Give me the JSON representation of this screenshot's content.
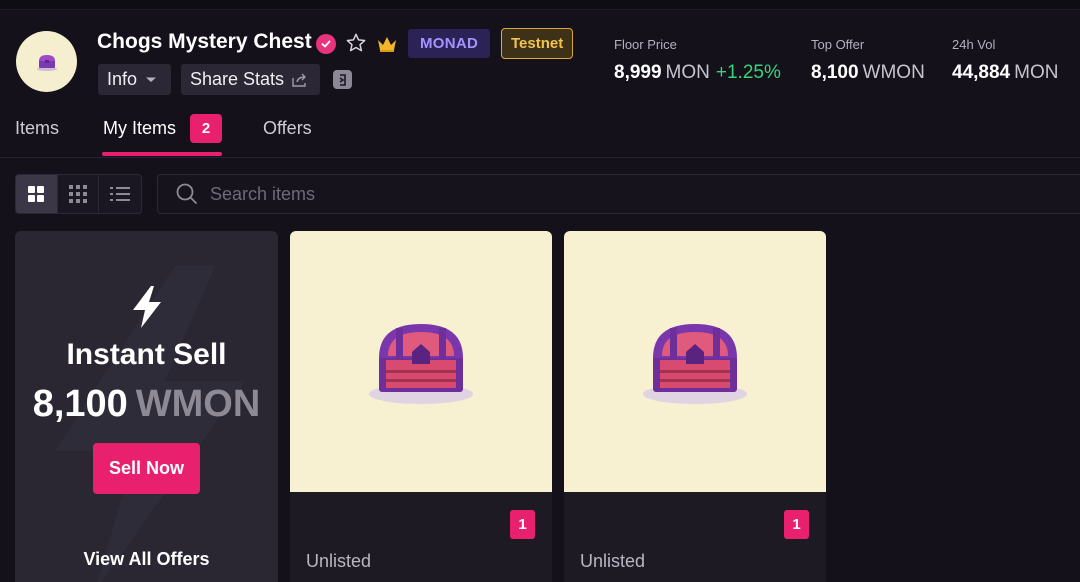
{
  "collection": {
    "name": "Chogs Mystery Chest",
    "network_tag": "MONAD",
    "env_tag": "Testnet",
    "info_label": "Info",
    "share_label": "Share Stats"
  },
  "stats": {
    "floor": {
      "label": "Floor Price",
      "value": "8,999",
      "unit": "MON",
      "change": "+1.25%"
    },
    "top_offer": {
      "label": "Top Offer",
      "value": "8,100",
      "unit": "WMON"
    },
    "volume": {
      "label": "24h Vol",
      "value": "44,884",
      "unit": "MON"
    }
  },
  "tabs": {
    "items": "Items",
    "my_items": "My Items",
    "my_items_count": "2",
    "offers": "Offers"
  },
  "search": {
    "placeholder": "Search items"
  },
  "instant_sell": {
    "title": "Instant Sell",
    "amount": "8,100",
    "unit": "WMON",
    "button": "Sell Now",
    "view_all": "View All Offers"
  },
  "items": [
    {
      "quantity": "1",
      "status": "Unlisted"
    },
    {
      "quantity": "1",
      "status": "Unlisted"
    }
  ],
  "colors": {
    "accent": "#e8206e",
    "background": "#14111b",
    "positive": "#39d37a",
    "item_bg": "#f7f0d1"
  }
}
